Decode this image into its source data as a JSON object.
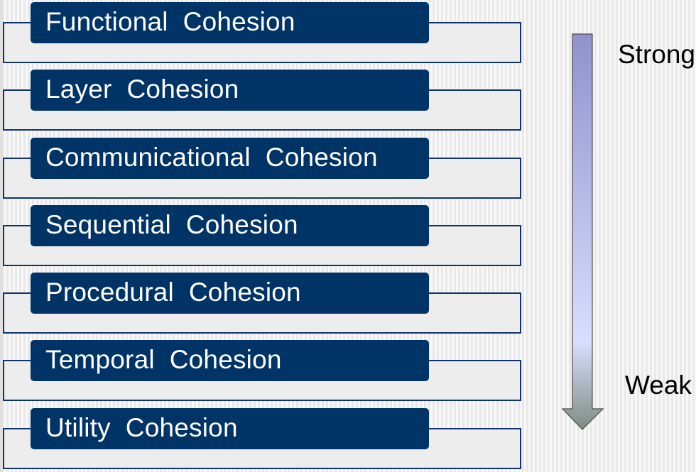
{
  "cohesion_levels": [
    {
      "label": "Functional  Cohesion"
    },
    {
      "label": "Layer  Cohesion"
    },
    {
      "label": "Communicational  Cohesion"
    },
    {
      "label": "Sequential  Cohesion"
    },
    {
      "label": "Procedural  Cohesion"
    },
    {
      "label": "Temporal  Cohesion"
    },
    {
      "label": "Utility  Cohesion"
    }
  ],
  "scale": {
    "top_label": "Strong",
    "bottom_label": "Weak",
    "gradient_colors": [
      "#8f92cc",
      "#d8deff",
      "#7f8d82"
    ]
  },
  "colors": {
    "label_fill": "#003366",
    "frame_border": "#0f3469",
    "label_text": "#ffffff"
  }
}
